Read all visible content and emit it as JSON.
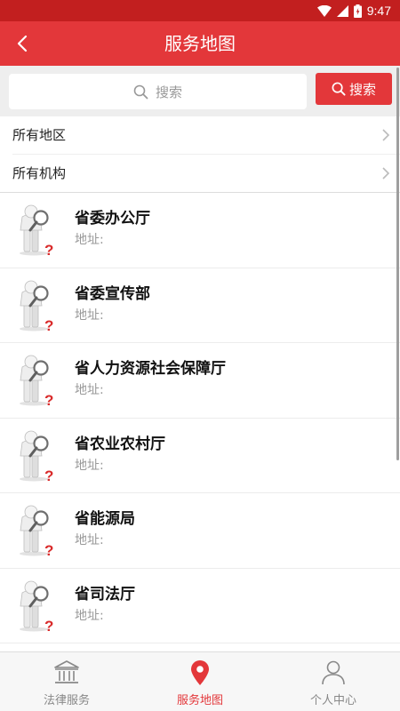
{
  "status_bar": {
    "time": "9:47"
  },
  "header": {
    "title": "服务地图"
  },
  "search": {
    "placeholder": "搜索",
    "button_label": "搜索"
  },
  "filters": [
    {
      "label": "所有地区"
    },
    {
      "label": "所有机构"
    }
  ],
  "organizations": [
    {
      "name": "省委办公厅",
      "address_label": "地址:"
    },
    {
      "name": "省委宣传部",
      "address_label": "地址:"
    },
    {
      "name": "省人力资源社会保障厅",
      "address_label": "地址:"
    },
    {
      "name": "省农业农村厅",
      "address_label": "地址:"
    },
    {
      "name": "省能源局",
      "address_label": "地址:"
    },
    {
      "name": "省司法厅",
      "address_label": "地址:"
    }
  ],
  "bottom_nav": {
    "tabs": [
      {
        "label": "法律服务",
        "icon": "courthouse-icon",
        "active": false
      },
      {
        "label": "服务地图",
        "icon": "map-pin-icon",
        "active": true
      },
      {
        "label": "个人中心",
        "icon": "user-icon",
        "active": false
      }
    ]
  },
  "colors": {
    "primary": "#e3373a",
    "status_bar": "#c21f1f"
  }
}
